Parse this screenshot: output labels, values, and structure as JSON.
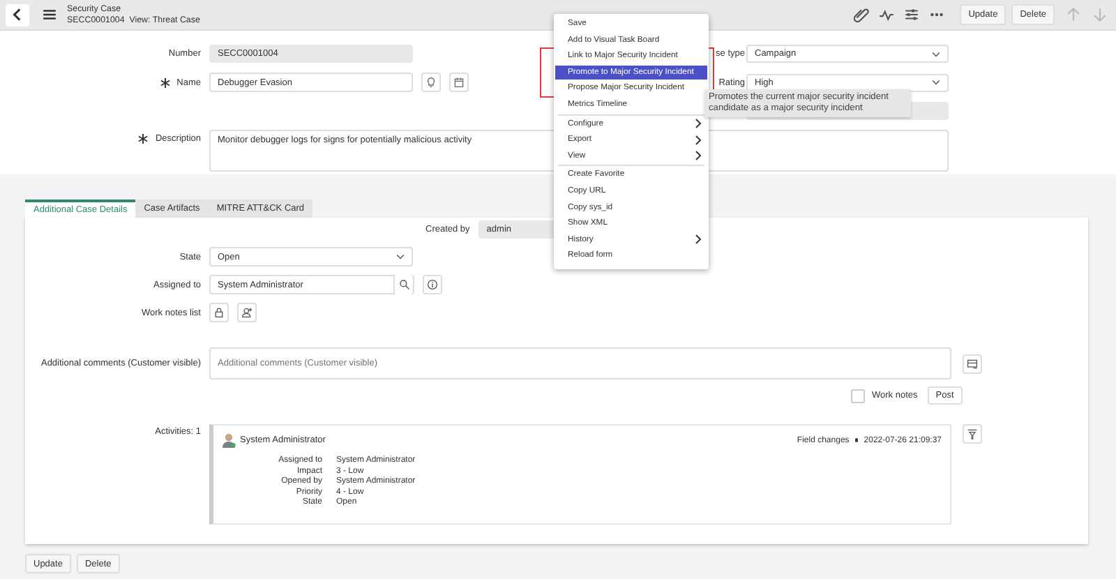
{
  "header": {
    "title": "Security Case",
    "subtitle": "SECC0001004  View: Threat Case",
    "buttons": [
      "Update",
      "Delete"
    ]
  },
  "form": {
    "number": {
      "label": "Number",
      "value": "SECC0001004"
    },
    "name": {
      "label": "Name",
      "required": true,
      "value": "Debugger Evasion"
    },
    "case_type": {
      "label": "se type",
      "value": "Campaign"
    },
    "rating": {
      "label": "Rating",
      "value": "High"
    },
    "description": {
      "label": "Description",
      "required": true,
      "value": "Monitor debugger logs for signs for potentially malicious activity"
    }
  },
  "context_menu": {
    "items": [
      {
        "label": "Save",
        "selected": false,
        "submenu": false,
        "divider_before": false
      },
      {
        "label": "Add to Visual Task Board",
        "selected": false,
        "submenu": false,
        "divider_before": false
      },
      {
        "label": "Link to Major Security Incident",
        "selected": false,
        "submenu": false,
        "divider_before": false
      },
      {
        "label": "Promote to Major Security Incident",
        "selected": true,
        "submenu": false,
        "divider_before": false
      },
      {
        "label": "Propose Major Security Incident",
        "selected": false,
        "submenu": false,
        "divider_before": false
      },
      {
        "label": "Metrics Timeline",
        "selected": false,
        "submenu": false,
        "divider_before": false
      },
      {
        "label": "Configure",
        "selected": false,
        "submenu": true,
        "divider_before": true
      },
      {
        "label": "Export",
        "selected": false,
        "submenu": true,
        "divider_before": false
      },
      {
        "label": "View",
        "selected": false,
        "submenu": true,
        "divider_before": false
      },
      {
        "label": "Create Favorite",
        "selected": false,
        "submenu": false,
        "divider_before": true
      },
      {
        "label": "Copy URL",
        "selected": false,
        "submenu": false,
        "divider_before": false
      },
      {
        "label": "Copy sys_id",
        "selected": false,
        "submenu": false,
        "divider_before": false
      },
      {
        "label": "Show XML",
        "selected": false,
        "submenu": false,
        "divider_before": false
      },
      {
        "label": "History",
        "selected": false,
        "submenu": true,
        "divider_before": false
      },
      {
        "label": "Reload form",
        "selected": false,
        "submenu": false,
        "divider_before": false
      }
    ]
  },
  "tooltip": "Promotes the current major security incident candidate as a major security incident",
  "tabs": [
    {
      "label": "Additional Case Details",
      "selected": true
    },
    {
      "label": "Case Artifacts",
      "selected": false
    },
    {
      "label": "MITRE ATT&CK Card",
      "selected": false
    }
  ],
  "details": {
    "created_by": {
      "label": "Created by",
      "value": "admin"
    },
    "state": {
      "label": "State",
      "value": "Open"
    },
    "assigned_to": {
      "label": "Assigned to",
      "value": "System Administrator"
    },
    "work_notes_list": {
      "label": "Work notes list"
    },
    "additional_comments": {
      "label": "Additional comments (Customer visible)",
      "placeholder": "Additional comments (Customer visible)"
    },
    "work_notes": {
      "label": "Work notes",
      "checked": false
    },
    "post": "Post"
  },
  "activities": {
    "label": "Activities: 1",
    "author": "System Administrator",
    "type": "Field changes",
    "timestamp": "2022-07-26 21:09:37",
    "changes": [
      {
        "field": "Assigned to",
        "value": "System Administrator"
      },
      {
        "field": "Impact",
        "value": "3 - Low"
      },
      {
        "field": "Opened by",
        "value": "System Administrator"
      },
      {
        "field": "Priority",
        "value": "4 - Low"
      },
      {
        "field": "State",
        "value": "Open"
      }
    ]
  },
  "footer_buttons": [
    "Update",
    "Delete"
  ]
}
